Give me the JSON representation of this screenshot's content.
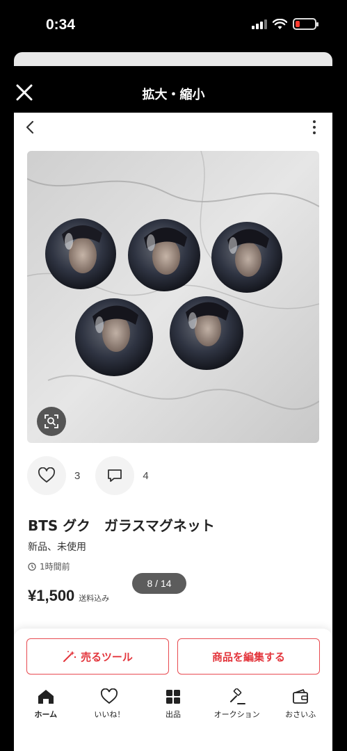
{
  "status_bar": {
    "time": "0:34"
  },
  "modal": {
    "title": "拡大・縮小"
  },
  "product": {
    "title": "BTS グク　ガラスマグネット",
    "condition": "新品、未使用",
    "posted": "1時間前",
    "price": "¥1,500",
    "shipping": "送料込み",
    "likes": "3",
    "comments": "4"
  },
  "actions": {
    "sell_tool": "売るツール",
    "edit_item": "商品を編集する"
  },
  "tabs": [
    {
      "label": "ホーム",
      "icon": "home-icon",
      "active": true
    },
    {
      "label": "いいね！",
      "icon": "heart-icon"
    },
    {
      "label": "出品",
      "icon": "grid-icon"
    },
    {
      "label": "オークション",
      "icon": "gavel-icon"
    },
    {
      "label": "おさいふ",
      "icon": "wallet-icon"
    }
  ],
  "page_indicator": "8 / 14",
  "colors": {
    "accent": "#e3353c",
    "battery_low": "#ff3b30"
  }
}
